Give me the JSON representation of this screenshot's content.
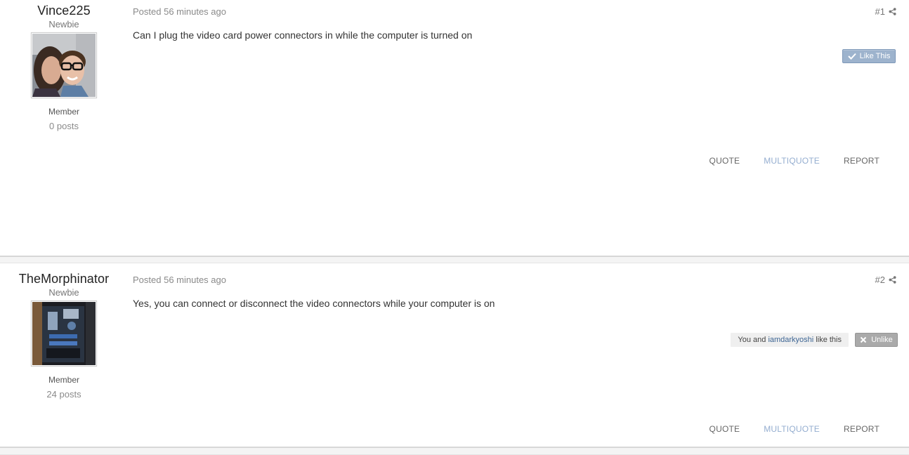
{
  "posts": [
    {
      "username": "Vince225",
      "rank_title": "Newbie",
      "avatar_icon": "avatar-photo-couple",
      "group": "Member",
      "post_count": "0 posts",
      "posted": "Posted 56 minutes ago",
      "number": "#1",
      "content": "Can I plug the video card power connectors in while the computer is turned on",
      "like_button": "Like This",
      "actions": {
        "quote": "QUOTE",
        "multiquote": "MULTIQUOTE",
        "report": "REPORT"
      }
    },
    {
      "username": "TheMorphinator",
      "rank_title": "Newbie",
      "avatar_icon": "avatar-photo-pc-case",
      "group": "Member",
      "post_count": "24 posts",
      "posted": "Posted 56 minutes ago",
      "number": "#2",
      "content": "Yes, you can connect or disconnect the video connectors while your computer is on",
      "likes": {
        "prefix": "You and",
        "user": "iamdarkyoshi",
        "suffix": "like this"
      },
      "unlike_button": "Unlike",
      "actions": {
        "quote": "QUOTE",
        "multiquote": "MULTIQUOTE",
        "report": "REPORT"
      }
    }
  ],
  "colors": {
    "like_button": "#9db3cd",
    "unlike_button": "#aaaaaa",
    "multiquote": "#95aed0",
    "link": "#3d6594"
  }
}
